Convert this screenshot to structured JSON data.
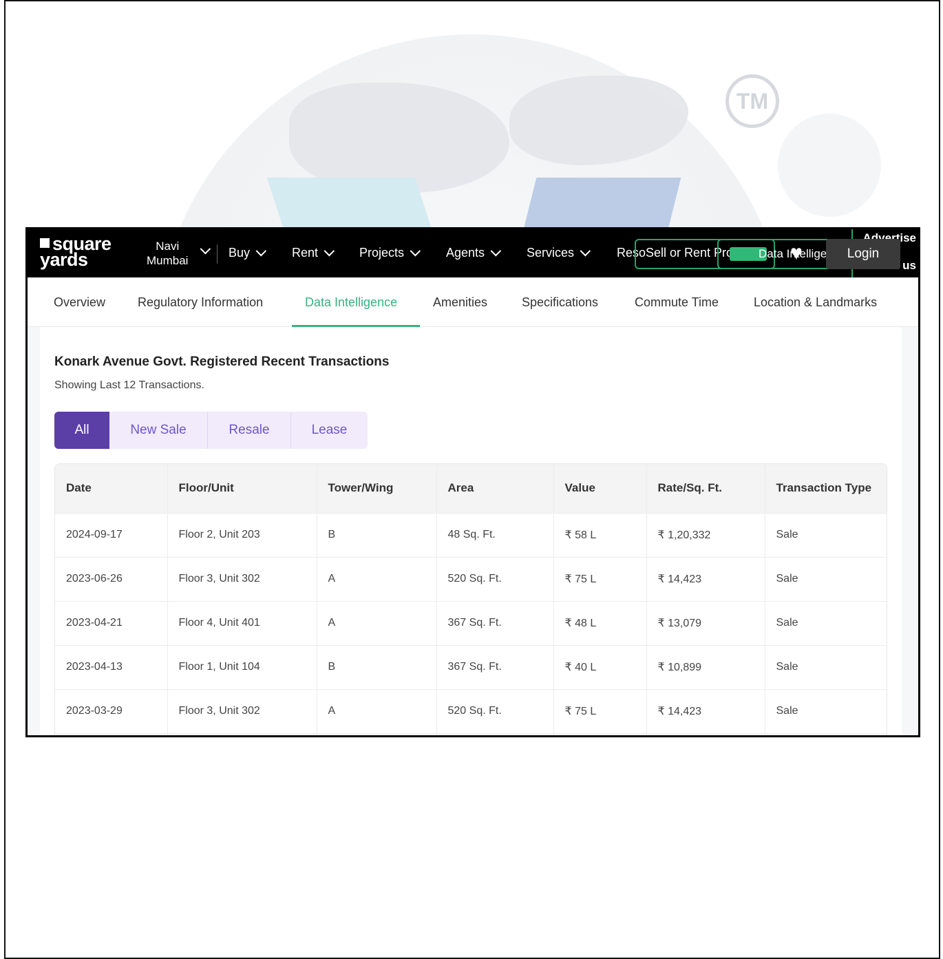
{
  "watermark": {
    "tm_text": "TM"
  },
  "header": {
    "logo_line1": "square",
    "logo_line2": "yards",
    "city_line1": "Navi",
    "city_line2": "Mumbai",
    "nav": [
      "Buy",
      "Rent",
      "Projects",
      "Agents",
      "Services"
    ],
    "resources_label": "Reso",
    "sell_rent_label": "Sell or Rent Property",
    "data_intel_label": "Data Intelligence",
    "advertise_line1": "Advertise",
    "advertise_line2": "with us",
    "login_label": "Login"
  },
  "subtabs": {
    "items": [
      "Overview",
      "Regulatory Information",
      "Data Intelligence",
      "Amenities",
      "Specifications",
      "Commute Time",
      "Location & Landmarks"
    ],
    "active": "Data Intelligence"
  },
  "transactions": {
    "title": "Konark Avenue Govt. Registered Recent Transactions",
    "subtitle": "Showing Last 12 Transactions.",
    "filters": [
      "All",
      "New Sale",
      "Resale",
      "Lease"
    ],
    "active_filter": "All",
    "columns": [
      "Date",
      "Floor/Unit",
      "Tower/Wing",
      "Area",
      "Value",
      "Rate/Sq. Ft.",
      "Transaction Type"
    ],
    "rows": [
      [
        "2024-09-17",
        "Floor 2, Unit 203",
        "B",
        "48 Sq. Ft.",
        "₹ 58 L",
        "₹ 1,20,332",
        "Sale"
      ],
      [
        "2023-06-26",
        "Floor 3, Unit 302",
        "A",
        "520 Sq. Ft.",
        "₹ 75 L",
        "₹ 14,423",
        "Sale"
      ],
      [
        "2023-04-21",
        "Floor 4, Unit 401",
        "A",
        "367 Sq. Ft.",
        "₹ 48 L",
        "₹ 13,079",
        "Sale"
      ],
      [
        "2023-04-13",
        "Floor 1, Unit 104",
        "B",
        "367 Sq. Ft.",
        "₹ 40 L",
        "₹ 10,899",
        "Sale"
      ],
      [
        "2023-03-29",
        "Floor 3, Unit 302",
        "A",
        "520 Sq. Ft.",
        "₹ 75 L",
        "₹ 14,423",
        "Sale"
      ],
      [
        "",
        "",
        "",
        "",
        "",
        "",
        ""
      ]
    ]
  },
  "colors": {
    "brand_green": "#36b37e",
    "filter_purple": "#5b3ea6",
    "nav_bg": "#000000"
  }
}
